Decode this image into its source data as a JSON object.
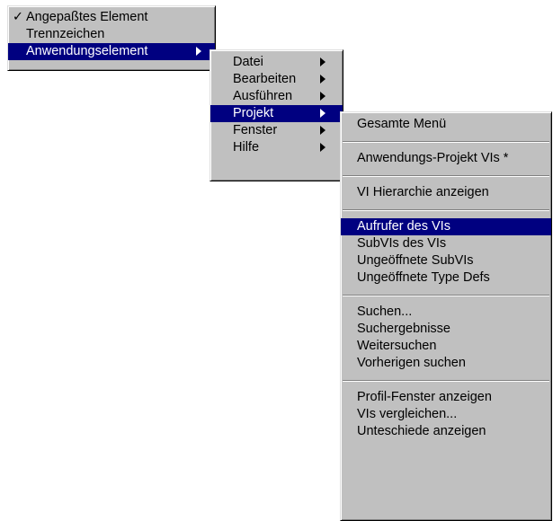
{
  "menu1": {
    "items": [
      {
        "check": "✓",
        "label": "Angepaßtes Element"
      },
      {
        "check": "",
        "label": "Trennzeichen"
      },
      {
        "check": "",
        "label": "Anwendungselement"
      }
    ]
  },
  "menu2": {
    "items": [
      {
        "label": "Datei"
      },
      {
        "label": "Bearbeiten"
      },
      {
        "label": "Ausführen"
      },
      {
        "label": "Projekt"
      },
      {
        "label": "Fenster"
      },
      {
        "label": "Hilfe"
      }
    ]
  },
  "menu3": {
    "items": [
      "Gesamte Menü",
      "Anwendungs-Projekt VIs *",
      "VI Hierarchie anzeigen",
      "Aufrufer des VIs",
      "SubVIs des VIs",
      "Ungeöffnete SubVIs",
      "Ungeöffnete Type Defs",
      "Suchen...",
      "Suchergebnisse",
      "Weitersuchen",
      "Vorherigen suchen",
      "Profil-Fenster anzeigen",
      "VIs vergleichen...",
      "Unteschiede anzeigen"
    ]
  },
  "colors": {
    "menu_background": "#c0c0c0",
    "highlight": "#000080",
    "highlight_text": "#ffffff"
  }
}
